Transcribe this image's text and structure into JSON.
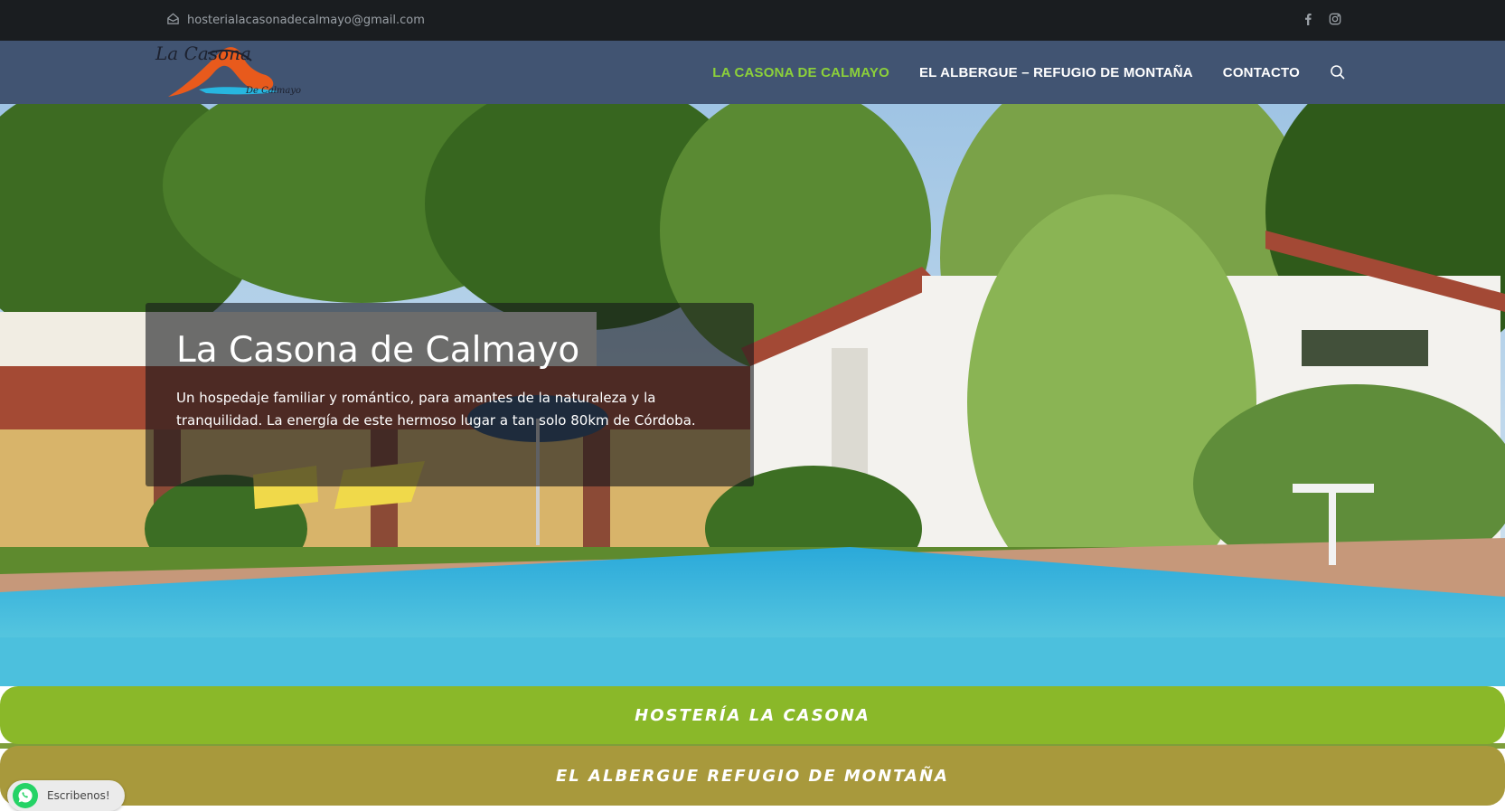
{
  "topbar": {
    "email": "hosterialacasonadecalmayo@gmail.com",
    "email_icon": "home-icon",
    "social": [
      {
        "name": "facebook",
        "icon": "facebook-icon"
      },
      {
        "name": "instagram",
        "icon": "instagram-icon"
      }
    ]
  },
  "header": {
    "logo": {
      "line1": "La Casona",
      "line2": "De Calmayo"
    },
    "nav": [
      {
        "label": "LA CASONA DE CALMAYO",
        "active": true
      },
      {
        "label": "EL ALBERGUE – REFUGIO DE MONTAÑA",
        "active": false
      },
      {
        "label": "CONTACTO",
        "active": false
      }
    ],
    "search_icon": "search-icon"
  },
  "hero": {
    "title": "La Casona de Calmayo",
    "description": "Un hospedaje familiar y romántico, para amantes de la naturaleza y la tranquilidad. La energía de este hermoso lugar a tan solo 80km de Córdoba."
  },
  "categories": [
    {
      "label": "HOSTERÍA LA CASONA",
      "color": "#8ab829"
    },
    {
      "label": "EL ALBERGUE REFUGIO DE MONTAÑA",
      "color": "#a8993c"
    }
  ],
  "whatsapp": {
    "label": "Escribenos!",
    "icon": "whatsapp-icon"
  },
  "colors": {
    "topbar": "#1a1d20",
    "header": "#415472",
    "nav_active": "#8cd13a",
    "nav_text": "#ffffff"
  }
}
